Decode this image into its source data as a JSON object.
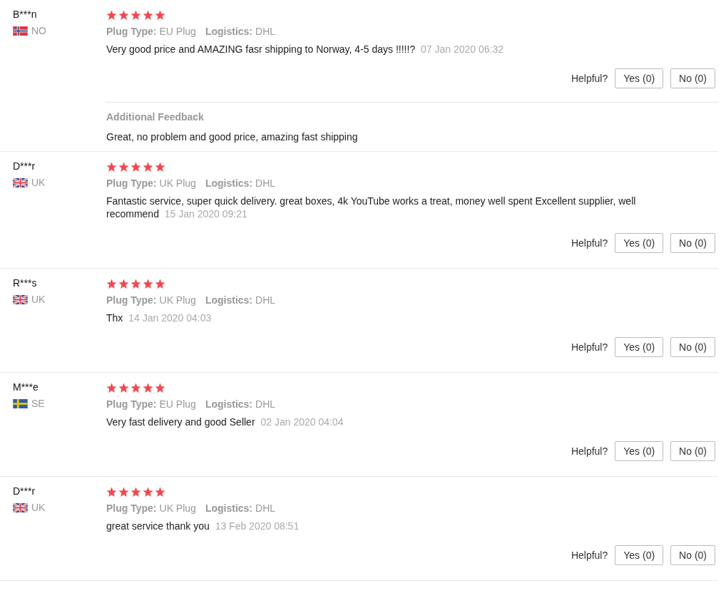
{
  "reviews": [
    {
      "name": "B***n",
      "kind": "norway",
      "country": "NO",
      "stars": 5,
      "plug_label": "Plug Type:",
      "plug": "EU Plug",
      "logistics_label": "Logistics:",
      "logistics": "DHL",
      "text": "Very good price and AMAZING fasr shipping to Norway, 4-5 days !!!!!?",
      "date": "07 Jan 2020 06:32",
      "helpful": "Helpful?",
      "yes": "Yes (0)",
      "no": "No (0)",
      "additional": {
        "title": "Additional Feedback",
        "text": "Great, no problem and good price, amazing fast shipping"
      }
    },
    {
      "name": "D***r",
      "kind": "uk",
      "country": "UK",
      "stars": 5,
      "plug_label": "Plug Type:",
      "plug": "UK Plug",
      "logistics_label": "Logistics:",
      "logistics": "DHL",
      "text": "Fantastic service, super quick delivery. great boxes, 4k YouTube works a treat, money well spent Excellent supplier, well recommend",
      "date": "15 Jan 2020 09:21",
      "helpful": "Helpful?",
      "yes": "Yes (0)",
      "no": "No (0)"
    },
    {
      "name": "R***s",
      "kind": "uk",
      "country": "UK",
      "stars": 5,
      "plug_label": "Plug Type:",
      "plug": "UK Plug",
      "logistics_label": "Logistics:",
      "logistics": "DHL",
      "text": "Thx",
      "date": "14 Jan 2020 04:03",
      "helpful": "Helpful?",
      "yes": "Yes (0)",
      "no": "No (0)"
    },
    {
      "name": "M***e",
      "kind": "sweden",
      "country": "SE",
      "stars": 5,
      "plug_label": "Plug Type:",
      "plug": "EU Plug",
      "logistics_label": "Logistics:",
      "logistics": "DHL",
      "text": "Very fast delivery and good Seller",
      "date": "02 Jan 2020 04:04",
      "helpful": "Helpful?",
      "yes": "Yes (0)",
      "no": "No (0)"
    },
    {
      "name": "D***r",
      "kind": "uk",
      "country": "UK",
      "stars": 5,
      "plug_label": "Plug Type:",
      "plug": "UK Plug",
      "logistics_label": "Logistics:",
      "logistics": "DHL",
      "text": "great service thank you",
      "date": "13 Feb 2020 08:51",
      "helpful": "Helpful?",
      "yes": "Yes (0)",
      "no": "No (0)"
    }
  ]
}
